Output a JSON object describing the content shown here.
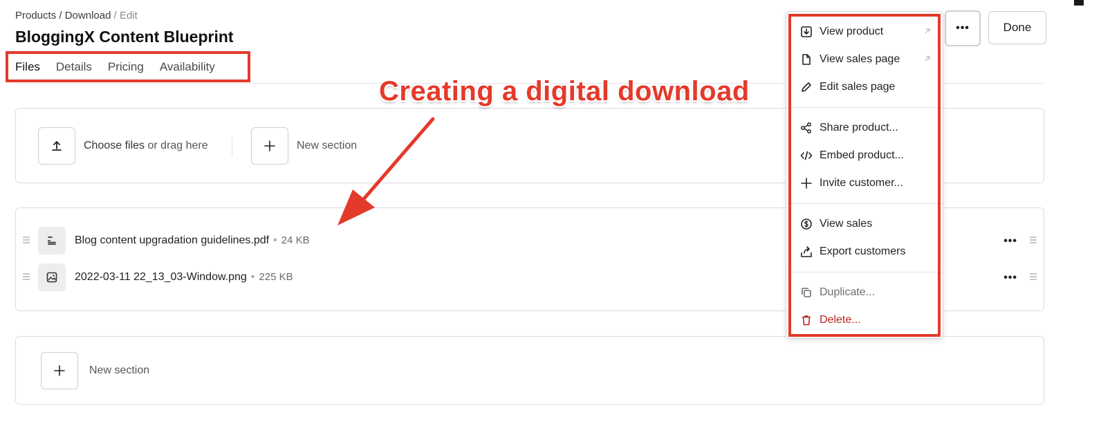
{
  "breadcrumb": {
    "products": "Products",
    "sep1": " / ",
    "download": "Download",
    "sep2": " / ",
    "edit": "Edit"
  },
  "page_title": "BloggingX Content Blueprint",
  "tabs": [
    {
      "label": "Files",
      "active": true
    },
    {
      "label": "Details"
    },
    {
      "label": "Pricing"
    },
    {
      "label": "Availability"
    }
  ],
  "upload": {
    "choose": "Choose files",
    "or_drag": " or drag here",
    "new_section": "New section"
  },
  "files": [
    {
      "name": "Blog content upgradation guidelines.pdf",
      "size": "24 KB",
      "icon": "file-text-icon"
    },
    {
      "name": "2022-03-11 22_13_03-Window.png",
      "size": "225 KB",
      "icon": "image-icon"
    }
  ],
  "file_dot": "•",
  "bottom": {
    "new_section": "New section"
  },
  "header_actions": {
    "more": "•••",
    "done": "Done"
  },
  "row_more": "•••",
  "menu": {
    "items": [
      {
        "label": "View product",
        "icon": "download-box-icon"
      },
      {
        "label": "View sales page",
        "icon": "file-icon"
      },
      {
        "label": "Edit sales page",
        "icon": "pencil-icon"
      },
      {
        "label": "Share product...",
        "icon": "share-icon"
      },
      {
        "label": "Embed product...",
        "icon": "code-icon"
      },
      {
        "label": "Invite customer...",
        "icon": "plus-icon"
      },
      {
        "label": "View sales",
        "icon": "dollar-circle-icon"
      },
      {
        "label": "Export customers",
        "icon": "export-icon"
      },
      {
        "label": "Duplicate...",
        "icon": "duplicate-icon"
      },
      {
        "label": "Delete...",
        "icon": "trash-icon"
      }
    ]
  },
  "annotation": {
    "text": "Creating a digital download"
  },
  "colors": {
    "accent_red": "#e43a2b",
    "danger": "#b3261e",
    "border": "#dcdcdc"
  }
}
